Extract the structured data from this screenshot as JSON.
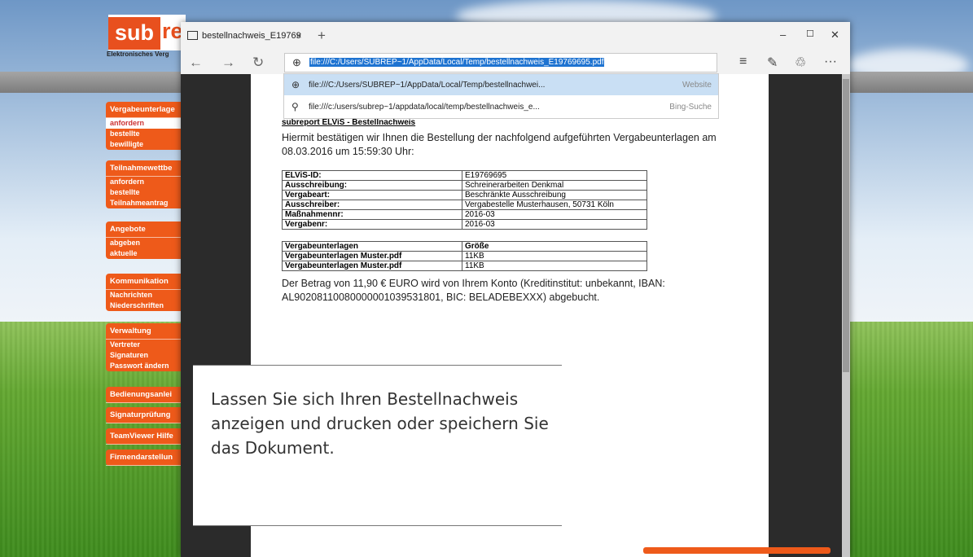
{
  "backapp": {
    "logo_part1": "sub",
    "logo_part2": "rep",
    "logo_sub": "Elektronisches Verg",
    "menus": [
      {
        "head": "Vergabeunterlage",
        "items": [
          "anfordern",
          "bestellte",
          "bewilligte"
        ]
      },
      {
        "head": "Teilnahmewettbe",
        "items": [
          "anfordern",
          "bestellte",
          "Teilnahmeantrag"
        ]
      },
      {
        "head": "Angebote",
        "items": [
          "abgeben",
          "aktuelle"
        ]
      },
      {
        "head": "Kommunikation",
        "items": [
          "Nachrichten",
          "Niederschriften"
        ]
      },
      {
        "head": "Verwaltung",
        "items": [
          "Vertreter",
          "Signaturen",
          "Passwort ändern"
        ]
      },
      {
        "head": "Bedienungsanlei",
        "items": []
      },
      {
        "head": "Signaturprüfung",
        "items": []
      },
      {
        "head": "TeamViewer Hilfe",
        "items": []
      },
      {
        "head": "Firmendarstellun",
        "items": []
      }
    ]
  },
  "browser": {
    "tab_title": "bestellnachweis_E19769",
    "tab_close": "×",
    "new_tab": "+",
    "window_controls": [
      "–",
      "☐",
      "✕"
    ],
    "nav": [
      "←",
      "→",
      "↻"
    ],
    "address": "file:///C:/Users/SUBREP~1/AppData/Local/Temp/bestellnachweis_E19769695.pdf",
    "tools": [
      "≡",
      "✎",
      "♲",
      "···"
    ],
    "suggestions": [
      {
        "text": "file:///C:/Users/SUBREP~1/AppData/Local/Temp/bestellnachwei...",
        "type": "Website"
      },
      {
        "text": "file:///c:/users/subrep~1/appdata/local/temp/bestellnachweis_e...",
        "type": "Bing-Suche"
      }
    ]
  },
  "pdf": {
    "title": "subreport ELViS - Bestellnachweis",
    "intro": "Hiermit bestätigen wir Ihnen die Bestellung der nachfolgend aufgeführten Vergabeunterlagen am 08.03.2016 um 15:59:30 Uhr:",
    "details": [
      {
        "k": "ELViS-ID:",
        "v": "E19769695"
      },
      {
        "k": "Ausschreibung:",
        "v": "Schreinerarbeiten Denkmal"
      },
      {
        "k": "Vergabeart:",
        "v": "Beschränkte Ausschreibung"
      },
      {
        "k": "Ausschreiber:",
        "v": "Vergabestelle Musterhausen, 50731 Köln"
      },
      {
        "k": "Maßnahmennr:",
        "v": "2016-03"
      },
      {
        "k": "Vergabenr:",
        "v": "2016-03"
      }
    ],
    "files": [
      {
        "k": "Vergabeunterlagen",
        "v": "Größe"
      },
      {
        "k": "Vergabeunterlagen Muster.pdf",
        "v": "11KB"
      },
      {
        "k": "Vergabeunterlagen Muster.pdf",
        "v": "11KB"
      }
    ],
    "payment": "Der Betrag von 11,90 € EURO wird von Ihrem Konto (Kreditinstitut: unbekannt, IBAN: AL90208110080000001039531801, BIC: BELADEBEXXX) abgebucht."
  },
  "caption": "Lassen Sie sich Ihren Bestellnachweis anzeigen und drucken oder speichern Sie das Dokument."
}
